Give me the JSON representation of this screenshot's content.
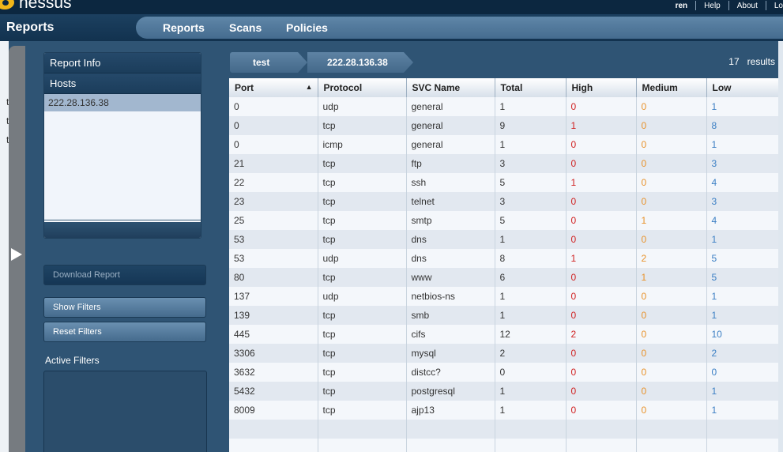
{
  "app": {
    "logo_text": "nessus",
    "page_title": "Reports"
  },
  "user_nav": {
    "user": "ren",
    "help": "Help",
    "about": "About",
    "logout": "Lo"
  },
  "main_nav": {
    "reports": "Reports",
    "scans": "Scans",
    "policies": "Policies"
  },
  "left_edge": {
    "fragments": [
      "t",
      "t",
      "t"
    ]
  },
  "side_panel": {
    "report_info": "Report Info",
    "hosts": "Hosts",
    "host_items": [
      "222.28.136.38"
    ],
    "download_report": "Download Report",
    "show_filters": "Show Filters",
    "reset_filters": "Reset Filters",
    "active_filters_label": "Active Filters"
  },
  "breadcrumb": {
    "report": "test",
    "host": "222.28.136.38"
  },
  "results": {
    "count": "17",
    "label": "results"
  },
  "table": {
    "columns": [
      "Port",
      "Protocol",
      "SVC Name",
      "Total",
      "High",
      "Medium",
      "Low"
    ],
    "sort_column": "Port",
    "sort_icon": "sort-asc-icon",
    "rows": [
      [
        "0",
        "udp",
        "general",
        "1",
        "0",
        "0",
        "1"
      ],
      [
        "0",
        "tcp",
        "general",
        "9",
        "1",
        "0",
        "8"
      ],
      [
        "0",
        "icmp",
        "general",
        "1",
        "0",
        "0",
        "1"
      ],
      [
        "21",
        "tcp",
        "ftp",
        "3",
        "0",
        "0",
        "3"
      ],
      [
        "22",
        "tcp",
        "ssh",
        "5",
        "1",
        "0",
        "4"
      ],
      [
        "23",
        "tcp",
        "telnet",
        "3",
        "0",
        "0",
        "3"
      ],
      [
        "25",
        "tcp",
        "smtp",
        "5",
        "0",
        "1",
        "4"
      ],
      [
        "53",
        "tcp",
        "dns",
        "1",
        "0",
        "0",
        "1"
      ],
      [
        "53",
        "udp",
        "dns",
        "8",
        "1",
        "2",
        "5"
      ],
      [
        "80",
        "tcp",
        "www",
        "6",
        "0",
        "1",
        "5"
      ],
      [
        "137",
        "udp",
        "netbios-ns",
        "1",
        "0",
        "0",
        "1"
      ],
      [
        "139",
        "tcp",
        "smb",
        "1",
        "0",
        "0",
        "1"
      ],
      [
        "445",
        "tcp",
        "cifs",
        "12",
        "2",
        "0",
        "10"
      ],
      [
        "3306",
        "tcp",
        "mysql",
        "2",
        "0",
        "0",
        "2"
      ],
      [
        "3632",
        "tcp",
        "distcc?",
        "0",
        "0",
        "0",
        "0"
      ],
      [
        "5432",
        "tcp",
        "postgresql",
        "1",
        "0",
        "0",
        "1"
      ],
      [
        "8009",
        "tcp",
        "ajp13",
        "1",
        "0",
        "0",
        "1"
      ]
    ]
  },
  "colors": {
    "high": "#d02020",
    "medium": "#e8922a",
    "low": "#3b7fc4",
    "header_bg": "#0c2740",
    "nav_bg": "#5f86a8"
  }
}
